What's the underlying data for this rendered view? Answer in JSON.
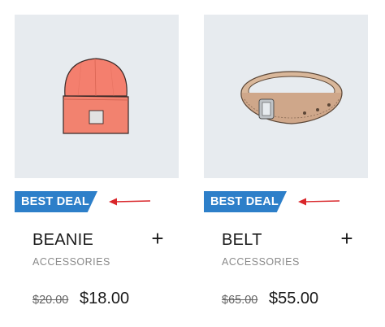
{
  "colors": {
    "badge": "#2d7fc9",
    "arrow": "#d9262a",
    "image_bg": "#e7ebef"
  },
  "products": [
    {
      "name": "BEANIE",
      "category": "ACCESSORIES",
      "badge": "BEST DEAL",
      "old_price": "$20.00",
      "price": "$18.00",
      "image_icon": "beanie-icon",
      "add_icon": "plus-icon"
    },
    {
      "name": "BELT",
      "category": "ACCESSORIES",
      "badge": "BEST DEAL",
      "old_price": "$65.00",
      "price": "$55.00",
      "image_icon": "belt-icon",
      "add_icon": "plus-icon"
    }
  ]
}
